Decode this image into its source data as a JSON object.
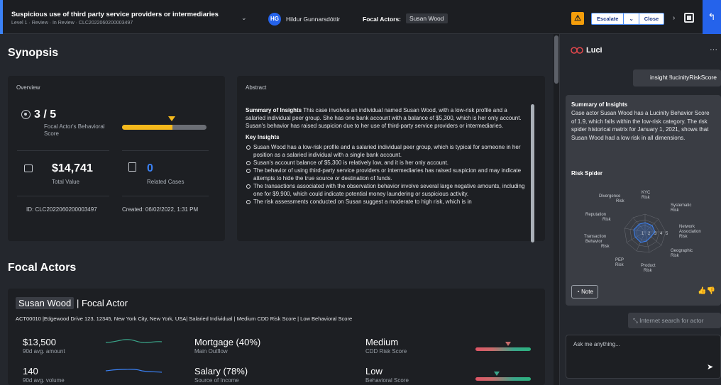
{
  "header": {
    "case_title": "Suspicious use of third party service providers or intermediaries",
    "case_sub": "Level 1 · Review · In Review · CLC2022060200003497",
    "assignee_initials": "HG",
    "assignee_name": "Hildur Gunnarsdóttir",
    "focal_actors_label": "Focal Actors:",
    "focal_actor": "Susan Wood",
    "escalate_label": "Escalate",
    "close_label": "Close",
    "warning_glyph": "⚠",
    "chevron_glyph": "⌄",
    "next_glyph": "›",
    "back_glyph": "↰"
  },
  "synopsis": {
    "title": "Synopsis",
    "overview": {
      "heading": "Overview",
      "score": "3 / 5",
      "score_label": "Focal Actor's Behavioral Score",
      "score_fraction": 0.6,
      "total_value": "$14,741",
      "total_value_label": "Total Value",
      "related_cases": "0",
      "related_cases_label": "Related Cases",
      "id_text": "ID: CLC2022060200003497",
      "created_text": "Created: 06/02/2022, 1:31 PM"
    },
    "abstract": {
      "heading": "Abstract",
      "summary_title": "Summary of Insights",
      "summary_text": " This case involves an individual named Susan Wood, with a low-risk profile and a salaried individual peer group. She has one bank account with a balance of $5,300, which is her only account. Susan's behavior has raised suspicion due to her use of third-party service providers or intermediaries.",
      "key_title": "Key Insights",
      "insights": [
        "Susan Wood has a low-risk profile and a salaried individual peer group, which is typical for someone in her position as a salaried individual with a single bank account.",
        "Susan's account balance of $5,300 is relatively low, and it is her only account.",
        "The behavior of using third-party service providers or intermediaries has raised suspicion and may indicate attempts to hide the true source or destination of funds.",
        "The transactions associated with the observation behavior involve several large negative amounts, including one for $9,900, which could indicate potential money laundering or suspicious activity.",
        "The risk assessments conducted on Susan suggest a moderate to high risk, which is in"
      ]
    }
  },
  "focal_actors": {
    "title": "Focal Actors",
    "name": "Susan Wood",
    "role": "| Focal Actor",
    "detail": "ACT00010 |Edgewood Drive 123, 12345, New York City, New York, USA| Salaried Individual | Medium CDD Risk Score | Low Behavioral Score",
    "metrics": [
      {
        "value": "$13,500",
        "label": "90d avg. amount"
      },
      {
        "value": "140",
        "label": "90d avg. volume"
      }
    ],
    "mid": [
      {
        "value": "Mortgage (40%)",
        "label": "Main Outflow"
      },
      {
        "value": "Salary (78%)",
        "label": "Source of Income"
      }
    ],
    "risk": [
      {
        "value": "Medium",
        "label": "CDD Risk Score"
      },
      {
        "value": "Low",
        "label": "Behavioral Score"
      }
    ]
  },
  "luci": {
    "title": "Luci",
    "more_glyph": "···",
    "user_query": "insight !lucinityRiskScore",
    "response_title": "Summary of Insights",
    "response_text": "Case actor Susan Wood has a Lucinity Behavior Score of 1.9, which falls within the low-risk category. The risk spider historical matrix for January 1, 2021, shows that Susan Wood had a low risk in all dimensions.",
    "risk_spider_title": "Risk Spider",
    "spider_labels": [
      "KYC Risk",
      "Systematic Risk",
      "Network Association Risk",
      "Geographic Risk",
      "Product Risk",
      "PEP Risk",
      "Transaction Behavior Risk",
      "Reputation Risk",
      "Divergence Risk"
    ],
    "spider_ticks": [
      "1",
      "2",
      "3",
      "4",
      "5"
    ],
    "note_label": "Note",
    "internet_search": "Internet search for actor",
    "ask_placeholder": "Ask me anything...",
    "send_glyph": "➤"
  },
  "colors": {
    "accent": "#2563eb",
    "warning": "#f59e0b",
    "score_fill": "#f5b91c",
    "sparkline": "#3aa68a",
    "sparkline2": "#3b82f6"
  }
}
